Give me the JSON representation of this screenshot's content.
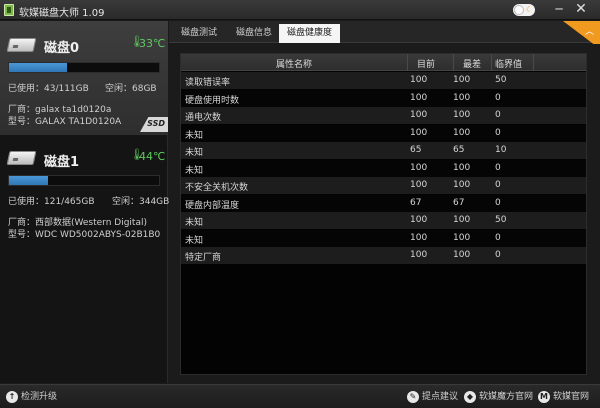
{
  "app": {
    "title": "软媒磁盘大师 1.09"
  },
  "window_controls": {
    "theme_icon": "moon-icon",
    "minimize": "─",
    "close": "✕"
  },
  "disks": [
    {
      "name": "磁盘0",
      "temperature": "33℃",
      "usage_fraction": 0.387,
      "used_label": "已使用：43/111GB",
      "free_label": "空闲：68GB",
      "vendor_label": "厂商：galax ta1d0120a",
      "model_label": "型号：GALAX TA1D0120A",
      "badge": "SSD",
      "active": true
    },
    {
      "name": "磁盘1",
      "temperature": "44℃",
      "usage_fraction": 0.26,
      "used_label": "已使用：121/465GB",
      "free_label": "空闲：344GB",
      "vendor_label": "厂商：西部数据(Western Digital)",
      "model_label": "型号：WDC WD5002ABYS-02B1B0",
      "badge": "",
      "active": false
    }
  ],
  "tabs": [
    {
      "label": "磁盘测试",
      "active": false
    },
    {
      "label": "磁盘信息",
      "active": false
    },
    {
      "label": "磁盘健康度",
      "active": true
    }
  ],
  "table": {
    "headers": {
      "attribute": "属性名称",
      "current": "目前",
      "worst": "最差",
      "threshold": "临界值"
    },
    "rows": [
      {
        "attribute": "读取错误率",
        "current": "100",
        "worst": "100",
        "threshold": "50"
      },
      {
        "attribute": "硬盘使用时数",
        "current": "100",
        "worst": "100",
        "threshold": "0"
      },
      {
        "attribute": "通电次数",
        "current": "100",
        "worst": "100",
        "threshold": "0"
      },
      {
        "attribute": "未知",
        "current": "100",
        "worst": "100",
        "threshold": "0"
      },
      {
        "attribute": "未知",
        "current": "65",
        "worst": "65",
        "threshold": "10"
      },
      {
        "attribute": "未知",
        "current": "100",
        "worst": "100",
        "threshold": "0"
      },
      {
        "attribute": "不安全关机次数",
        "current": "100",
        "worst": "100",
        "threshold": "0"
      },
      {
        "attribute": "硬盘内部温度",
        "current": "67",
        "worst": "67",
        "threshold": "0"
      },
      {
        "attribute": "未知",
        "current": "100",
        "worst": "100",
        "threshold": "50"
      },
      {
        "attribute": "未知",
        "current": "100",
        "worst": "100",
        "threshold": "0"
      },
      {
        "attribute": "特定厂商",
        "current": "100",
        "worst": "100",
        "threshold": "0"
      }
    ]
  },
  "statusbar": {
    "check_update": "检测升级",
    "feedback": "提点建议",
    "ruanmei_magic": "软媒魔方官网",
    "ruanmei_site": "软媒官网"
  },
  "colors": {
    "accent": "#f09a1f",
    "usage_bar": "#3a86c8",
    "temperature": "#5ec85e"
  }
}
